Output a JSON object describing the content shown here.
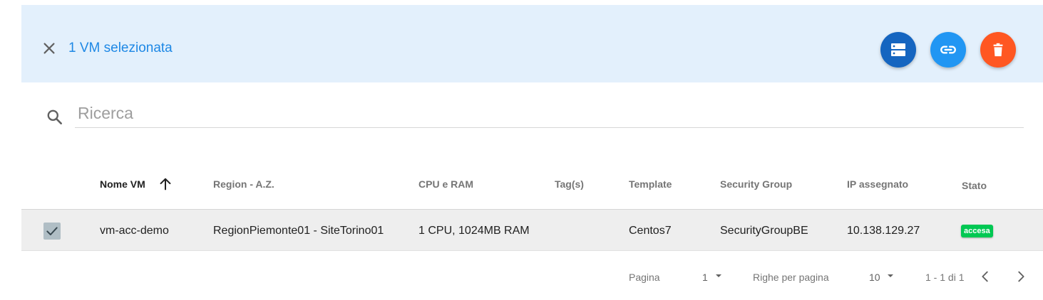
{
  "selection": {
    "text": "1 VM selezionata",
    "actions": [
      {
        "icon": "server-icon",
        "color": "#1565c0"
      },
      {
        "icon": "link-icon",
        "color": "#2196f3"
      },
      {
        "icon": "trash-icon",
        "color": "#ff5722"
      }
    ],
    "background": "#e3f0fc"
  },
  "search": {
    "placeholder": "Ricerca",
    "value": ""
  },
  "table": {
    "columns": [
      "Nome VM",
      "Region - A.Z.",
      "CPU e RAM",
      "Tag(s)",
      "Template",
      "Security Group",
      "IP assegnato",
      "Stato"
    ],
    "sorted_column": "Nome VM",
    "sort_direction": "ascending",
    "rows": [
      {
        "selected": true,
        "name": "vm-acc-demo",
        "region": "RegionPiemonte01 - SiteTorino01",
        "cpu_ram": "1 CPU, 1024MB RAM",
        "tags": "",
        "template": "Centos7",
        "security_group": "SecurityGroupBE",
        "ip": "10.138.129.27",
        "status": "accesa",
        "status_color": "#00c853"
      }
    ]
  },
  "pagination": {
    "page_label": "Pagina",
    "page": "1",
    "rows_label": "Righe per pagina",
    "rows_per_page": "10",
    "range": "1 - 1 di 1"
  }
}
